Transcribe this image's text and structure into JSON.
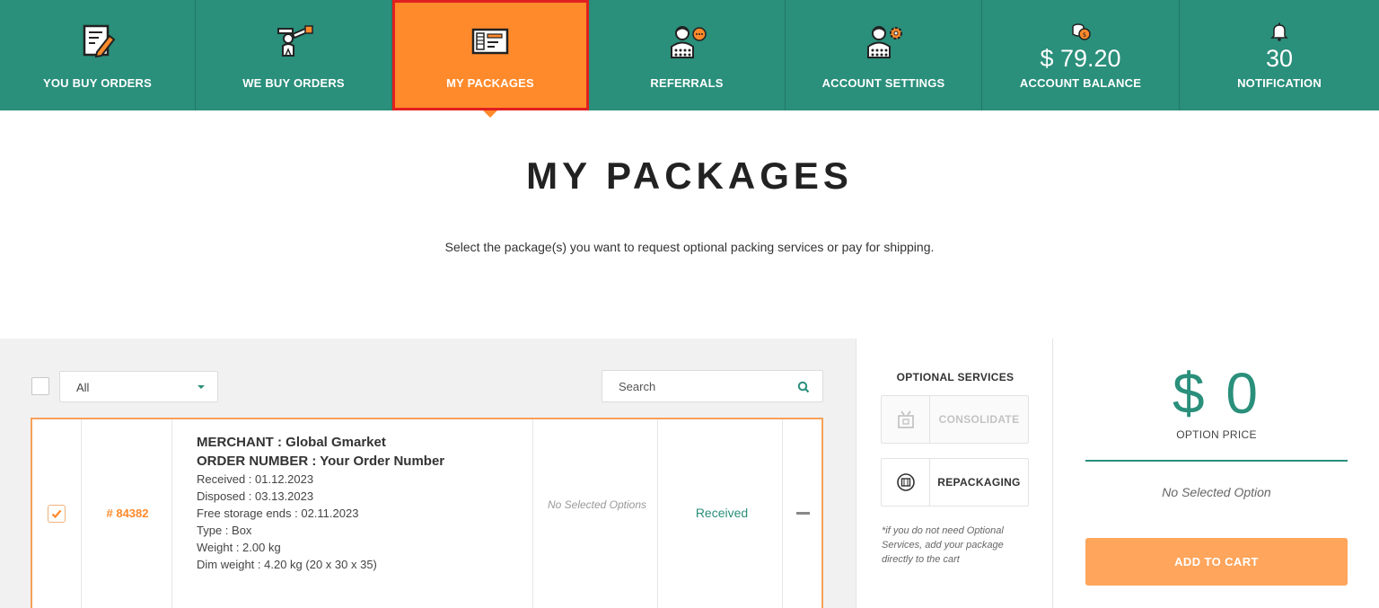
{
  "nav": {
    "items": [
      {
        "label": "YOU BUY ORDERS",
        "icon": "edit-order-icon"
      },
      {
        "label": "WE BUY ORDERS",
        "icon": "pointing-person-icon"
      },
      {
        "label": "MY PACKAGES",
        "icon": "package-label-icon",
        "active": true
      },
      {
        "label": "REFERRALS",
        "icon": "person-chat-icon"
      },
      {
        "label": "ACCOUNT SETTINGS",
        "icon": "person-gear-icon"
      },
      {
        "label": "ACCOUNT BALANCE",
        "value": "$ 79.20",
        "icon": "coins-icon"
      },
      {
        "label": "NOTIFICATION",
        "value": "30",
        "icon": "bell-icon"
      }
    ]
  },
  "header": {
    "title": "MY PACKAGES",
    "subtitle": "Select the package(s) you want to request optional packing services or pay for shipping."
  },
  "list": {
    "filter": {
      "selected": "All"
    },
    "search": {
      "placeholder": "Search"
    },
    "packages": [
      {
        "checked": true,
        "id": "# 84382",
        "merchant": "MERCHANT : Global Gmarket",
        "order_number": "ORDER NUMBER : Your Order Number",
        "received": "Received : 01.12.2023",
        "disposed": "Disposed : 03.13.2023",
        "free_storage": "Free storage ends : 02.11.2023",
        "type": "Type : Box",
        "weight": "Weight : 2.00 kg",
        "dim_weight": "Dim weight : 4.20 kg (20 x 30 x 35)",
        "options": "No Selected Options",
        "status": "Received"
      }
    ]
  },
  "optional_services": {
    "title": "OPTIONAL SERVICES",
    "consolidate_label": "CONSOLIDATE",
    "repackaging_label": "REPACKAGING",
    "note": "*if you do not need Optional Services, add your package directly to the cart"
  },
  "summary": {
    "price": "$ 0",
    "price_label": "OPTION PRICE",
    "no_option": "No Selected Option",
    "add_to_cart": "ADD TO CART"
  },
  "colors": {
    "brand_green": "#2a8f7b",
    "accent_orange": "#ff8a2b",
    "cart_orange": "#ffa55c",
    "highlight_red": "#e02020"
  }
}
